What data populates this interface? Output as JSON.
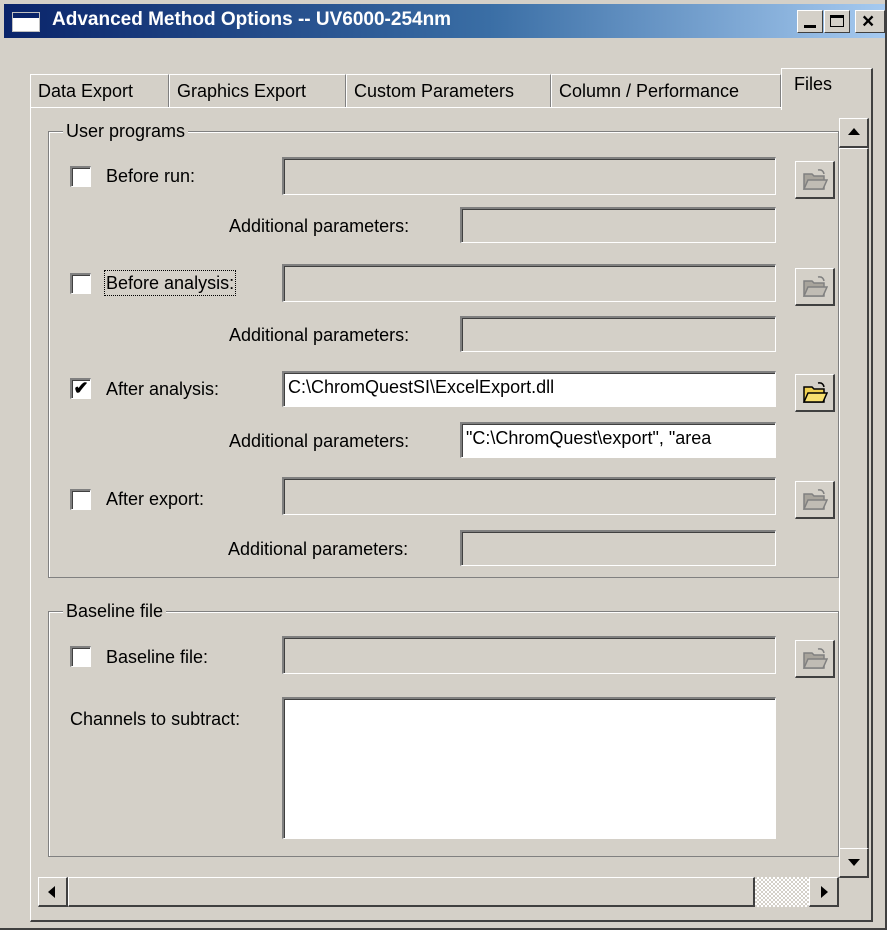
{
  "window": {
    "title": "Advanced Method Options -- UV6000-254nm"
  },
  "tabs": [
    {
      "label": "Data Export",
      "selected": false
    },
    {
      "label": "Graphics Export",
      "selected": false
    },
    {
      "label": "Custom Parameters",
      "selected": false
    },
    {
      "label": "Column / Performance",
      "selected": false
    },
    {
      "label": "Files",
      "selected": true
    }
  ],
  "user_programs": {
    "group_label": "User programs",
    "additional_label": "Additional parameters:",
    "before_run": {
      "label": "Before run:",
      "checked": false,
      "checkmark": "",
      "value": "",
      "params": ""
    },
    "before_analysis": {
      "label": "Before analysis:",
      "checked": false,
      "checkmark": "",
      "value": "",
      "params": ""
    },
    "after_analysis": {
      "label": "After analysis:",
      "checked": true,
      "checkmark": "✔",
      "value": "C:\\ChromQuestSI\\ExcelExport.dll",
      "params": "\"C:\\ChromQuest\\export\", \"area"
    },
    "after_export": {
      "label": "After export:",
      "checked": false,
      "checkmark": "",
      "value": "",
      "params": ""
    }
  },
  "baseline": {
    "group_label": "Baseline file",
    "file_label": "Baseline file:",
    "checked": false,
    "checkmark": "",
    "value": "",
    "channels_label": "Channels to subtract:",
    "channels_value": ""
  },
  "icons": {
    "browse": "open-folder-icon",
    "disabled_color": "#a8a49c",
    "enabled_color": "#f0d050",
    "titlebar_color": "#0a246a"
  }
}
